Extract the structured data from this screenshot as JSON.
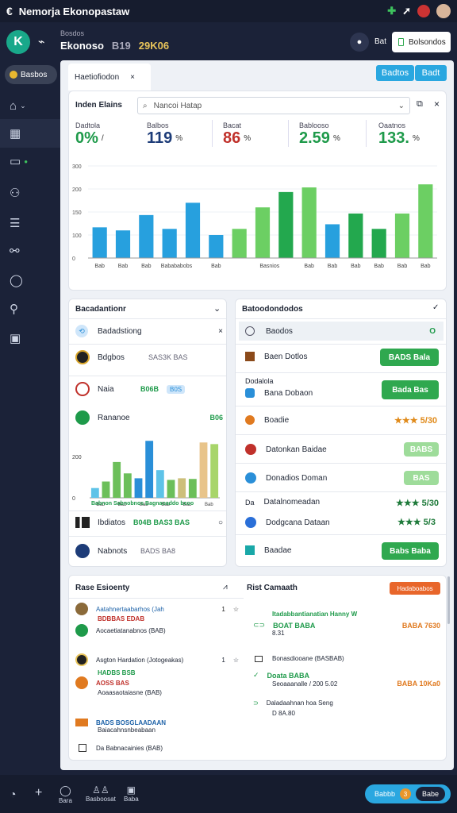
{
  "status": {
    "title": "Nemorja Ekonopastaw"
  },
  "header": {
    "section": "Bosdos",
    "title": "Ekonoso",
    "id_a": "B19",
    "id_b": "29K06",
    "user_btn": "Bat",
    "action_btn": "Bolsondos"
  },
  "sidebar": {
    "top_badge": "Basbos"
  },
  "main": {
    "tab": "Haetiofiodon",
    "top_btn_a": "Badtos",
    "top_btn_b": "Badt",
    "panel_title": "Inden Elains",
    "search_placeholder": "Nancoi Hatap",
    "kpis": [
      {
        "label": "Dadtola",
        "value": "0%",
        "suffix": "/",
        "color": "#1e9a4a"
      },
      {
        "label": "Balbos",
        "value": "119",
        "suffix": "%",
        "color": "#1d3c78"
      },
      {
        "label": "Bacat",
        "value": "86",
        "suffix": "%",
        "color": "#c0312b"
      },
      {
        "label": "Bablooso",
        "value": "2.59",
        "suffix": "%",
        "color": "#1e9a4a"
      },
      {
        "label": "Oaatnos",
        "value": "133.",
        "suffix": "%",
        "color": "#1e9a4a"
      }
    ],
    "chart_ticks": [
      "300",
      "200",
      "150",
      "100",
      "0"
    ],
    "chart_cats": [
      "Bab",
      "Bab",
      "Bab",
      "Babababobs",
      "Bab",
      "Basnios",
      "Bab",
      "Bab",
      "Bab",
      "Bab",
      "Bab",
      "Bab"
    ]
  },
  "chart_data": [
    {
      "type": "bar",
      "yticks": [
        "300",
        "200",
        "150",
        "100",
        "0"
      ],
      "categories": [
        "Bab",
        "Bab",
        "Bab",
        "Babababobs",
        "Bab",
        "Basnios",
        "Bab",
        "Bab",
        "Bab",
        "Bab",
        "Bab",
        "Bab"
      ],
      "values": [
        100,
        90,
        140,
        95,
        180,
        75,
        95,
        165,
        215,
        230,
        110,
        145,
        95,
        145,
        240
      ],
      "colors": [
        "#27a0de",
        "#27a0de",
        "#27a0de",
        "#27a0de",
        "#27a0de",
        "#27a0de",
        "#6ccf63",
        "#6ccf63",
        "#23a84e",
        "#6ccf63",
        "#27a0de",
        "#23a84e",
        "#23a84e",
        "#6ccf63",
        "#6ccf63"
      ]
    },
    {
      "type": "bar",
      "yticks": [
        "200",
        "0"
      ],
      "categories": [
        "Bab",
        "Bab",
        "Bab",
        "Bab",
        "Bab",
        "Bab"
      ],
      "values": [
        30,
        50,
        110,
        75,
        60,
        175,
        85,
        55,
        60,
        58,
        170,
        165
      ],
      "colors": [
        "#5ec3e8",
        "#6cbf5a",
        "#6cbf5a",
        "#6cbf5a",
        "#2a8fd8",
        "#2a8fd8",
        "#5ec3e8",
        "#6cbf5a",
        "#cdbf7a",
        "#6cbf5a",
        "#e8c48a",
        "#a8d56a"
      ]
    }
  ],
  "left_panel": {
    "title": "Bacadantionr",
    "selected": "Badadstiong",
    "rows": [
      {
        "name": "Bdgbos",
        "value": "SAS3K BAS"
      },
      {
        "name": "Naia",
        "value": "B06B",
        "badge": "B0S"
      },
      {
        "name": "Rananoe",
        "value": "B06"
      },
      {
        "name": "Ibdiatos",
        "value": "B04B  BAS3 BAS"
      },
      {
        "name": "Nabnots",
        "value": "BADS BA8"
      }
    ],
    "legend": "Babnon Sabnobnos Bagnaoaddo bcoo"
  },
  "right_panel": {
    "title": "Batoodondodos",
    "selected": "Baodos",
    "rows": [
      {
        "name": "Baen Dotlos",
        "btn": "BADS Bala"
      },
      {
        "name": "Dodalola",
        "sub": "Bana Dobaon",
        "btn": "Bada Bas"
      },
      {
        "name": "Boadie",
        "stars": "★★★ 5/30"
      },
      {
        "name": "Datonkan Baidae",
        "btn": "BABS"
      },
      {
        "name": "Donadios Doman",
        "btn": "BAS"
      },
      {
        "name": "Datalnomeadan",
        "stars": "★★★ 5/30"
      },
      {
        "name": "Dodgcana Dataan",
        "stars": "★★★ 5/3"
      },
      {
        "name": "Baadae",
        "btn": "Babs Baba"
      }
    ]
  },
  "activity": {
    "title": "Rase Esioenty",
    "items": [
      {
        "title": "Aatahnertaabarhos (Jah",
        "tag": "BDBBAS EDAB",
        "sub": "Aocaetiatanabnos (BAB)",
        "count": "1"
      },
      {
        "title": "Asgton Hardation (Jotogeakas)",
        "tag": "HADBS BSB",
        "tag2": "AOSS BAS",
        "sub": "Aoaasaotaiasne (BAB)",
        "count": "1"
      },
      {
        "title": "BADS BOSGLAADAAN",
        "sub": "Baiacahnsnbeabaan"
      },
      {
        "title": "Da Babnacainies (BAB)"
      }
    ]
  },
  "comments": {
    "title": "Rist Camaath",
    "btn": "Hadaboabos",
    "items": [
      {
        "title": "Itadabbantianatian Hanny W",
        "val": "BOAT BABA",
        "right": "BABA 7630",
        "sub": "8.31"
      },
      {
        "title": "Bonasdiooane (BASBAB)"
      },
      {
        "title": "Doata BABA",
        "sub": "Seoaaanalle / 200 5.02",
        "right": "BABA 10Ka0"
      },
      {
        "title": "Daladaahnan hoa Seng",
        "sub": "D 8A.80"
      }
    ]
  },
  "bottom": {
    "items": [
      "Bara",
      "Basboosat",
      "Baba"
    ],
    "pill": "Babbb",
    "pill2": "Babe",
    "pill_count": "3"
  }
}
